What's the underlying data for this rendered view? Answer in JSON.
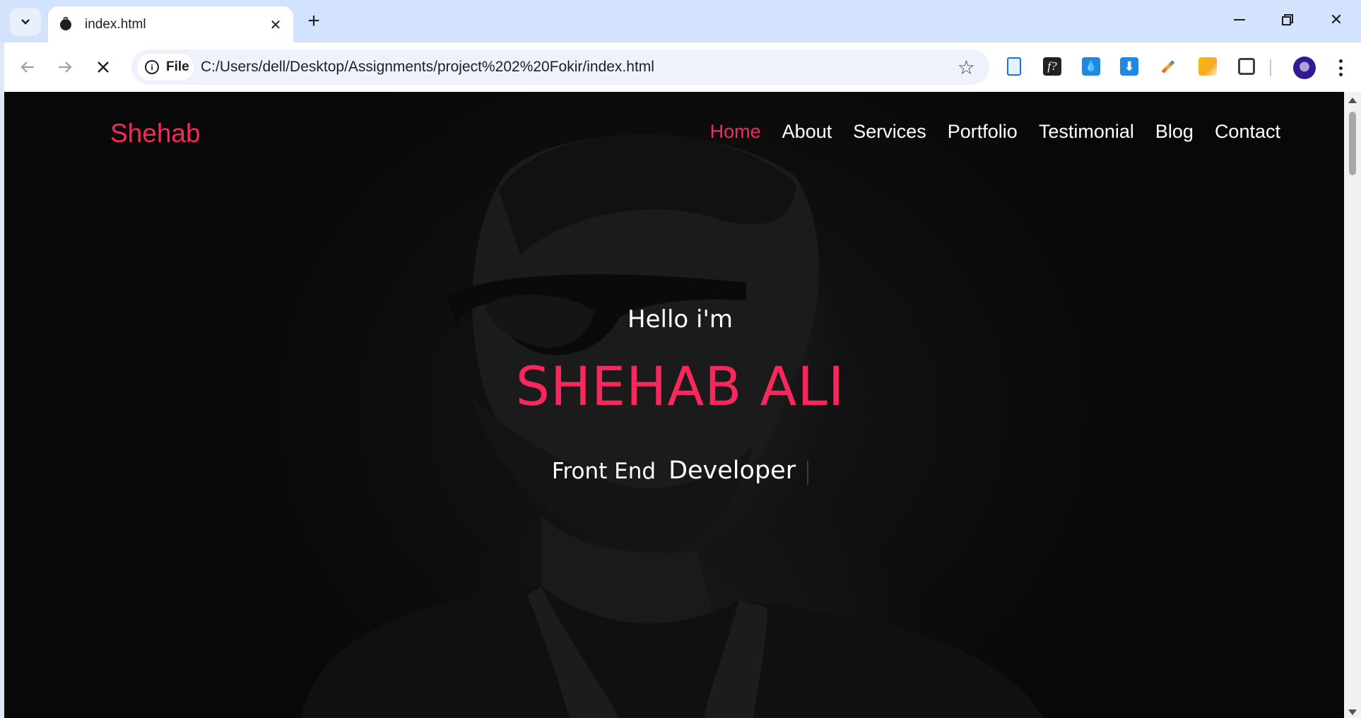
{
  "browser": {
    "tab_title": "index.html",
    "address_chip": "File",
    "url": "C:/Users/dell/Desktop/Assignments/project%202%20Fokir/index.html"
  },
  "site": {
    "logo": "Shehab",
    "nav": [
      "Home",
      "About",
      "Services",
      "Portfolio",
      "Testimonial",
      "Blog",
      "Contact"
    ],
    "active_nav": "Home",
    "hero": {
      "greeting": "Hello i'm",
      "name": "SHEHAB ALI",
      "role_prefix": "Front End",
      "role_typed": "Developer"
    }
  },
  "colors": {
    "accent": "#f9285c",
    "hero_background": "#0b0b0b",
    "tabbar": "#d3e3fd"
  }
}
